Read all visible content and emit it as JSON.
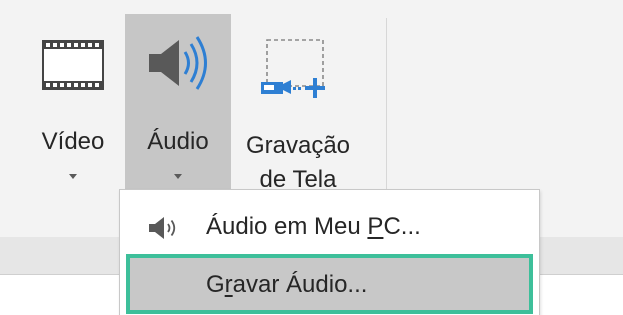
{
  "ribbon": {
    "buttons": [
      {
        "id": "video",
        "label": "Vídeo",
        "icon": "film-strip-icon"
      },
      {
        "id": "audio",
        "label": "Áudio",
        "icon": "speaker-icon",
        "state": "pressed"
      },
      {
        "id": "screen",
        "label_line1": "Gravação",
        "label_line2": "de Tela",
        "icon": "screen-recording-icon"
      }
    ]
  },
  "menu": {
    "items": [
      {
        "label_before": "Áudio em Meu ",
        "label_mnemonic": "P",
        "label_after": "C...",
        "icon": "speaker-icon"
      },
      {
        "label_before": "G",
        "label_mnemonic": "r",
        "label_after": "avar Áudio...",
        "state": "highlighted"
      }
    ]
  },
  "colors": {
    "ribbon_bg": "#f3f3f3",
    "pressed_bg": "#c6c6c6",
    "highlight_border": "#3dbf9a",
    "highlight_bg": "#c8c8c8",
    "icon_blue": "#2e7fd3"
  }
}
